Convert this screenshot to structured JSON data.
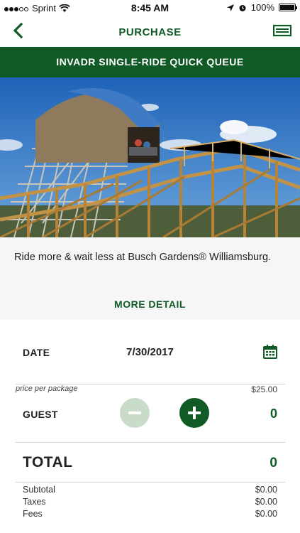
{
  "status_bar": {
    "carrier": "Sprint",
    "time": "8:45 AM",
    "battery": "100%"
  },
  "nav": {
    "title": "PURCHASE",
    "back_icon": "chevron-left-icon",
    "ticket_icon": "ticket-icon"
  },
  "product": {
    "title": "INVADR SINGLE-RIDE QUICK QUEUE",
    "description": "Ride more & wait less at Busch Gardens® Williamsburg.",
    "more_detail_label": "MORE DETAIL",
    "image_icon": "wooden-coaster-photo"
  },
  "purchase": {
    "date_label": "DATE",
    "date_value": "7/30/2017",
    "calendar_icon": "calendar-icon",
    "price_label": "price per package",
    "price_value": "$25.00",
    "guest_label": "GUEST",
    "guest_count": "0",
    "total_label": "TOTAL",
    "total_value": "0"
  },
  "summary": [
    {
      "label": "Subtotal",
      "amount": "$0.00"
    },
    {
      "label": "Taxes",
      "amount": "$0.00"
    },
    {
      "label": "Fees",
      "amount": "$0.00"
    }
  ],
  "colors": {
    "brand_green": "#0f5a25",
    "light_green": "#c8dcc9",
    "panel_gray": "#f6f6f6"
  }
}
